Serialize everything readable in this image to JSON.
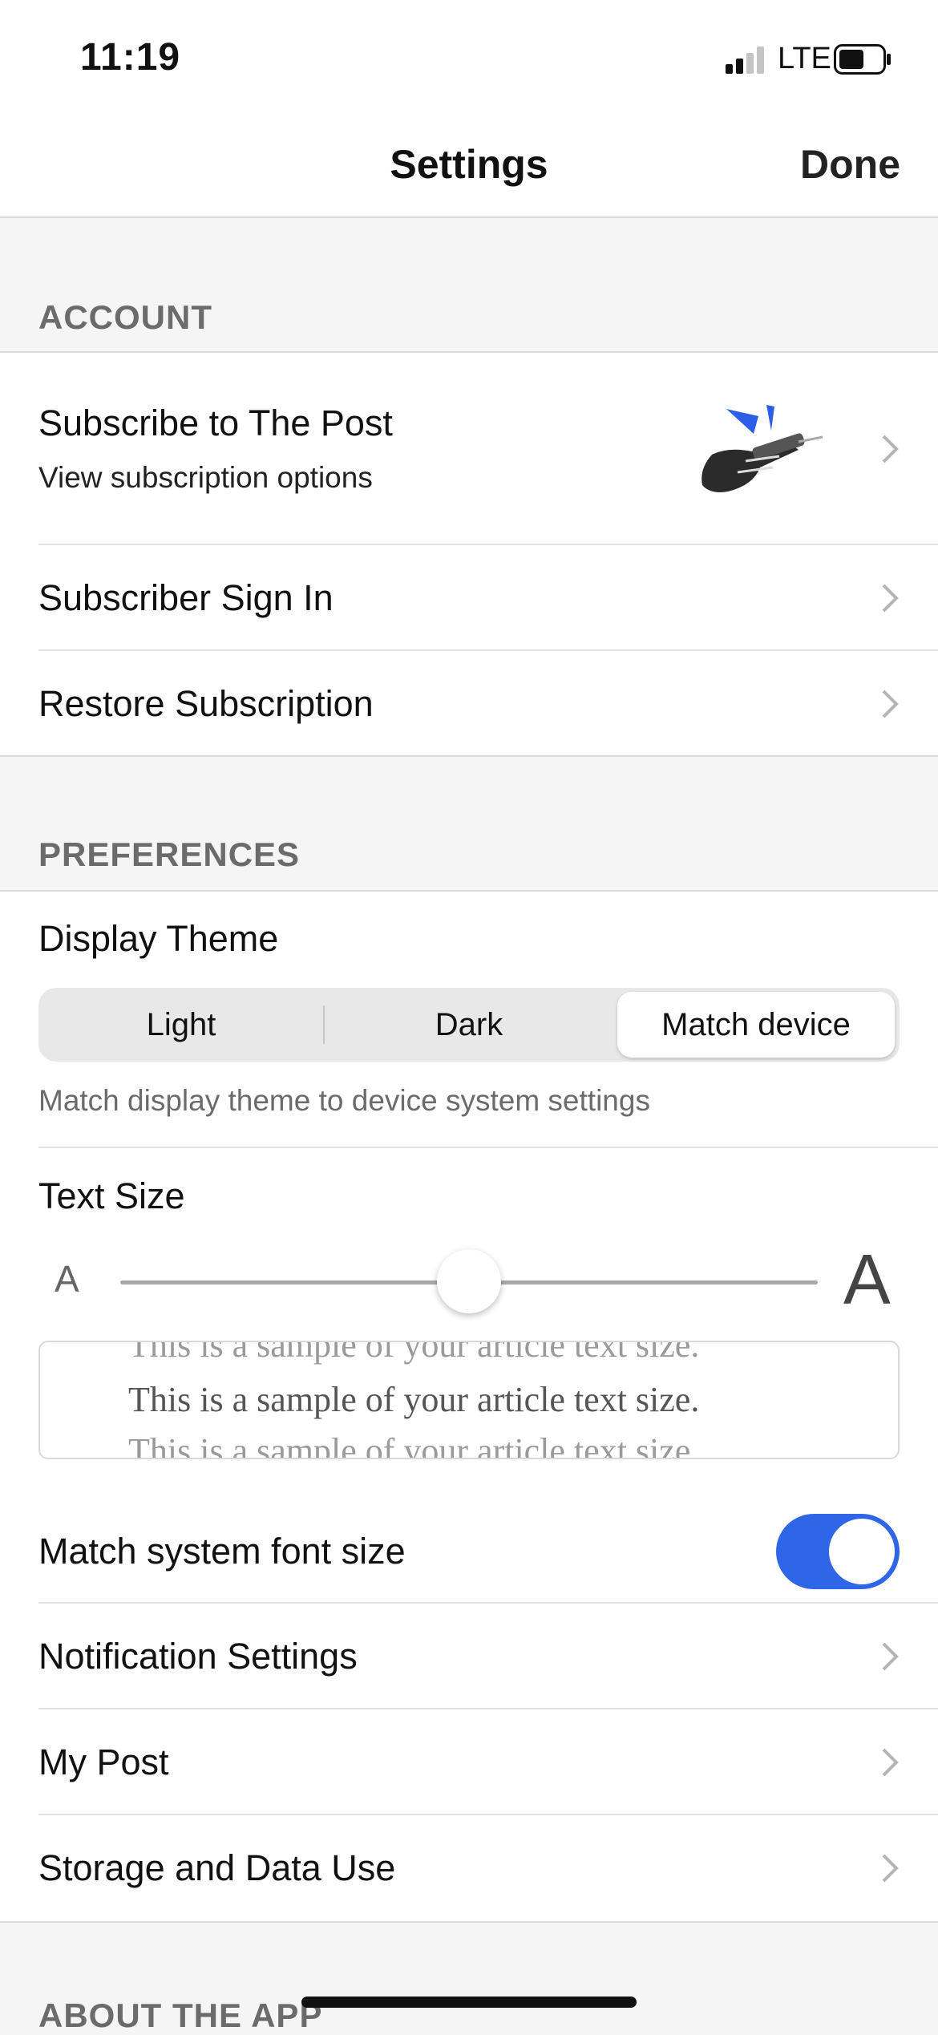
{
  "status_bar": {
    "time": "11:19",
    "network": "LTE"
  },
  "nav": {
    "title": "Settings",
    "done_label": "Done"
  },
  "account": {
    "header": "ACCOUNT",
    "subscribe_title": "Subscribe to The Post",
    "subscribe_subtitle": "View subscription options",
    "sign_in": "Subscriber Sign In",
    "restore": "Restore Subscription"
  },
  "preferences": {
    "header": "PREFERENCES",
    "display_theme_label": "Display Theme",
    "theme_options": [
      "Light",
      "Dark",
      "Match device"
    ],
    "theme_selected": "Match device",
    "theme_hint": "Match display theme to device system settings",
    "text_size_label": "Text Size",
    "slider_min_label": "A",
    "slider_max_label": "A",
    "slider_value_fraction": 0.5,
    "sample_text": "This is a sample of your article text size.",
    "match_system_font_label": "Match system font size",
    "match_system_font_on": true,
    "notification_settings": "Notification Settings",
    "my_post": "My Post",
    "storage": "Storage and Data Use"
  },
  "about": {
    "header": "ABOUT THE APP"
  },
  "colors": {
    "accent": "#2f66e8",
    "promo_blue": "#2c5fe6",
    "section_gray": "#6b6b6b"
  }
}
